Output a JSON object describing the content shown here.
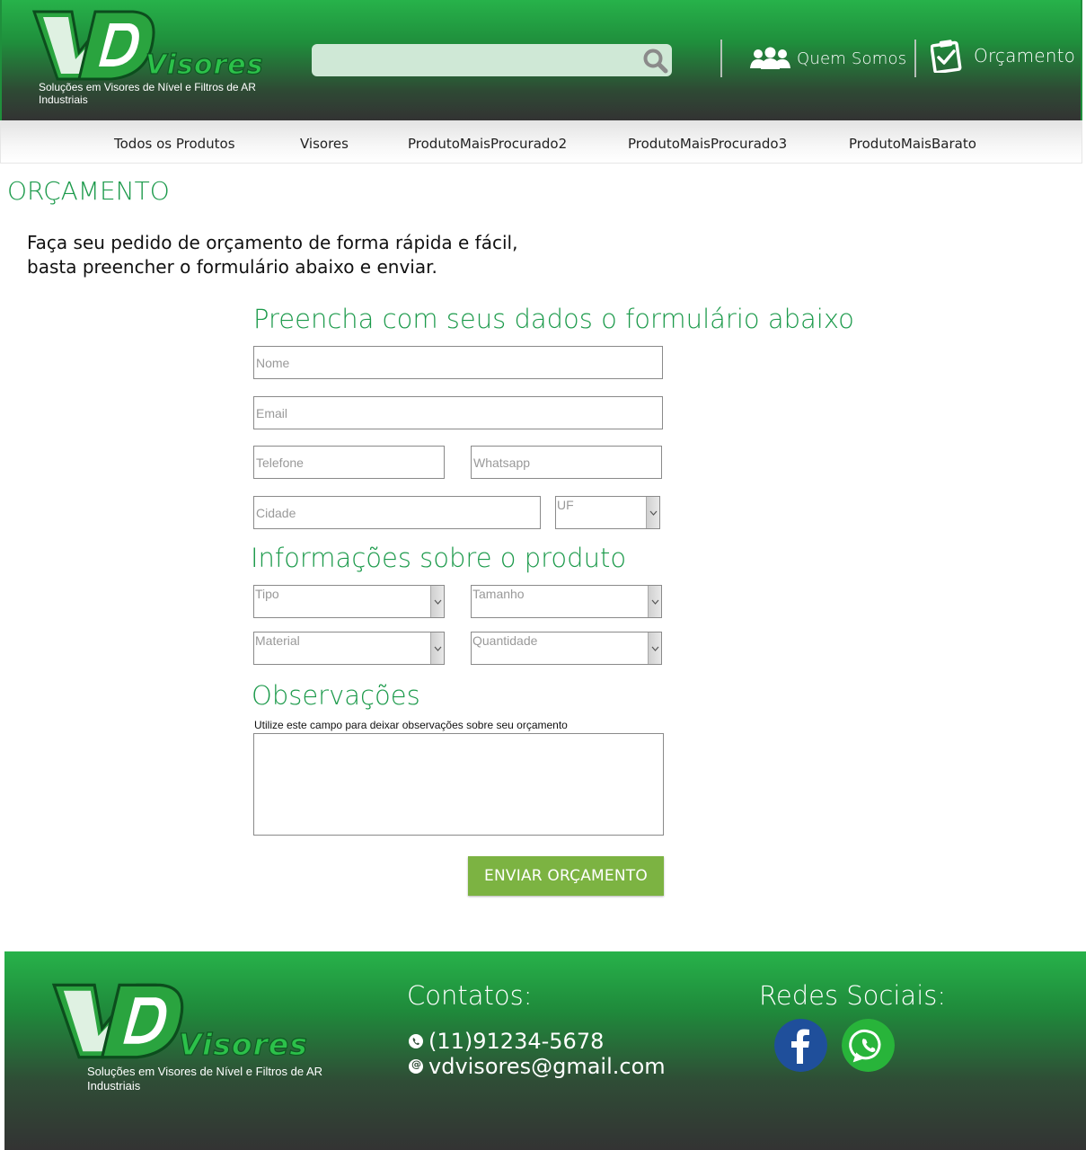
{
  "header": {
    "logo": {
      "mark": "VD",
      "brand": "Visores",
      "tagline_line1": "Soluções em Visores de Nível e Filtros de AR",
      "tagline_line2": "Industriais"
    },
    "search": {
      "placeholder": "",
      "icon": "search-icon"
    },
    "nav": [
      {
        "label": "Quem Somos",
        "icon": "users-icon"
      },
      {
        "label": "Orçamento",
        "icon": "clipboard-check-icon"
      }
    ]
  },
  "categories": [
    "Todos os Produtos",
    "Visores",
    "ProdutoMaisProcurado2",
    "ProdutoMaisProcurado3",
    "ProdutoMaisBarato"
  ],
  "page": {
    "title": "ORÇAMENTO",
    "intro_line1": "Faça seu pedido de orçamento de forma rápida e fácil,",
    "intro_line2": "basta preencher o formulário abaixo e enviar."
  },
  "form": {
    "personal_title": "Preencha com seus dados o formulário abaixo",
    "nome_placeholder": "Nome",
    "email_placeholder": "Email",
    "telefone_placeholder": "Telefone",
    "whatsapp_placeholder": "Whatsapp",
    "cidade_placeholder": "Cidade",
    "uf_placeholder": "UF",
    "product_title": "Informações sobre o produto",
    "tipo_placeholder": "Tipo",
    "tamanho_placeholder": "Tamanho",
    "material_placeholder": "Material",
    "quantidade_placeholder": "Quantidade",
    "obs_title": "Observações",
    "obs_hint": "Utilize este campo para deixar observações sobre seu orçamento",
    "submit_label": "ENVIAR ORÇAMENTO"
  },
  "footer": {
    "contacts_title": "Contatos:",
    "phone": "(11)91234-5678",
    "email": "vdvisores@gmail.com",
    "social_title": "Redes Sociais:",
    "social": [
      {
        "name": "facebook-icon",
        "color": "#1f4f9b"
      },
      {
        "name": "whatsapp-icon",
        "color": "#28b43a"
      }
    ]
  },
  "colors": {
    "brand_green": "#1c9a4b",
    "button_green": "#7cb342",
    "header_dark": "#333333"
  }
}
